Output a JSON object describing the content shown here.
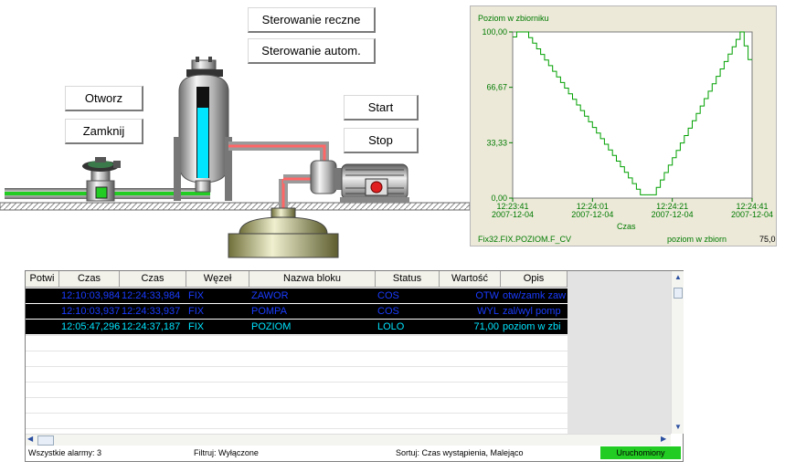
{
  "buttons": {
    "sterowanie_reczne": "Sterowanie reczne",
    "sterowanie_autom": "Sterowanie autom.",
    "otworz": "Otworz",
    "zamknij": "Zamknij",
    "start": "Start",
    "stop": "Stop"
  },
  "chart": {
    "title": "Poziom w zbiorniku",
    "xlabel": "Czas",
    "tag": "Fix32.FIX.POZIOM.F_CV",
    "desc": "poziom w zbiorn",
    "value": "75,0"
  },
  "chart_data": {
    "type": "line",
    "title": "Poziom w zbiorniku",
    "xlabel": "Czas",
    "ylabel": "",
    "ylim": [
      0,
      100
    ],
    "y_ticks": [
      "100,00",
      "66,67",
      "33,33",
      "0,00"
    ],
    "x_ticks": [
      {
        "time": "12:23:41",
        "date": "2007-12-04"
      },
      {
        "time": "12:24:01",
        "date": "2007-12-04"
      },
      {
        "time": "12:24:21",
        "date": "2007-12-04"
      },
      {
        "time": "12:24:41",
        "date": "2007-12-04"
      }
    ],
    "series": [
      {
        "color": "#00a000",
        "x": [
          "12:23:41",
          "12:23:42",
          "12:23:44",
          "12:24:13",
          "12:24:16",
          "12:24:38",
          "12:24:41"
        ],
        "y": [
          97,
          100,
          100,
          2,
          2,
          100,
          75
        ]
      }
    ],
    "grid": false,
    "legend": "none"
  },
  "alarms": {
    "columns": [
      "Potwi",
      "Czas",
      "Czas",
      "Węzeł",
      "Nazwa bloku",
      "Status",
      "Wartość",
      "Opis"
    ],
    "rows": [
      {
        "potw": "",
        "czas1": "12:10:03,984",
        "czas2": "12:24:33,984",
        "wezel": "FIX",
        "blok": "ZAWOR",
        "status": "COS",
        "wartosc": "OTW",
        "opis": "otw/zamk zaw",
        "color": "#1a3cff"
      },
      {
        "potw": "",
        "czas1": "12:10:03,937",
        "czas2": "12:24:33,937",
        "wezel": "FIX",
        "blok": "POMPA",
        "status": "COS",
        "wartosc": "WYL",
        "opis": "zal/wyl pomp",
        "color": "#1a3cff"
      },
      {
        "potw": "",
        "czas1": "12:05:47,296",
        "czas2": "12:24:37,187",
        "wezel": "FIX",
        "blok": "POZIOM",
        "status": "LOLO",
        "wartosc": "71,00",
        "opis": "poziom w zbi",
        "color": "#00e5ff"
      }
    ],
    "status_bar": {
      "all": "Wszystkie alarmy: 3",
      "filter": "Filtruj: Wyłączone",
      "sort": "Sortuj: Czas wystąpienia, Malejąco",
      "state": "Uruchomiony"
    }
  },
  "colors": {
    "pipe_green": "#22cc22",
    "tank_level": "#00e5ff",
    "status_ok": "#22cc22"
  }
}
